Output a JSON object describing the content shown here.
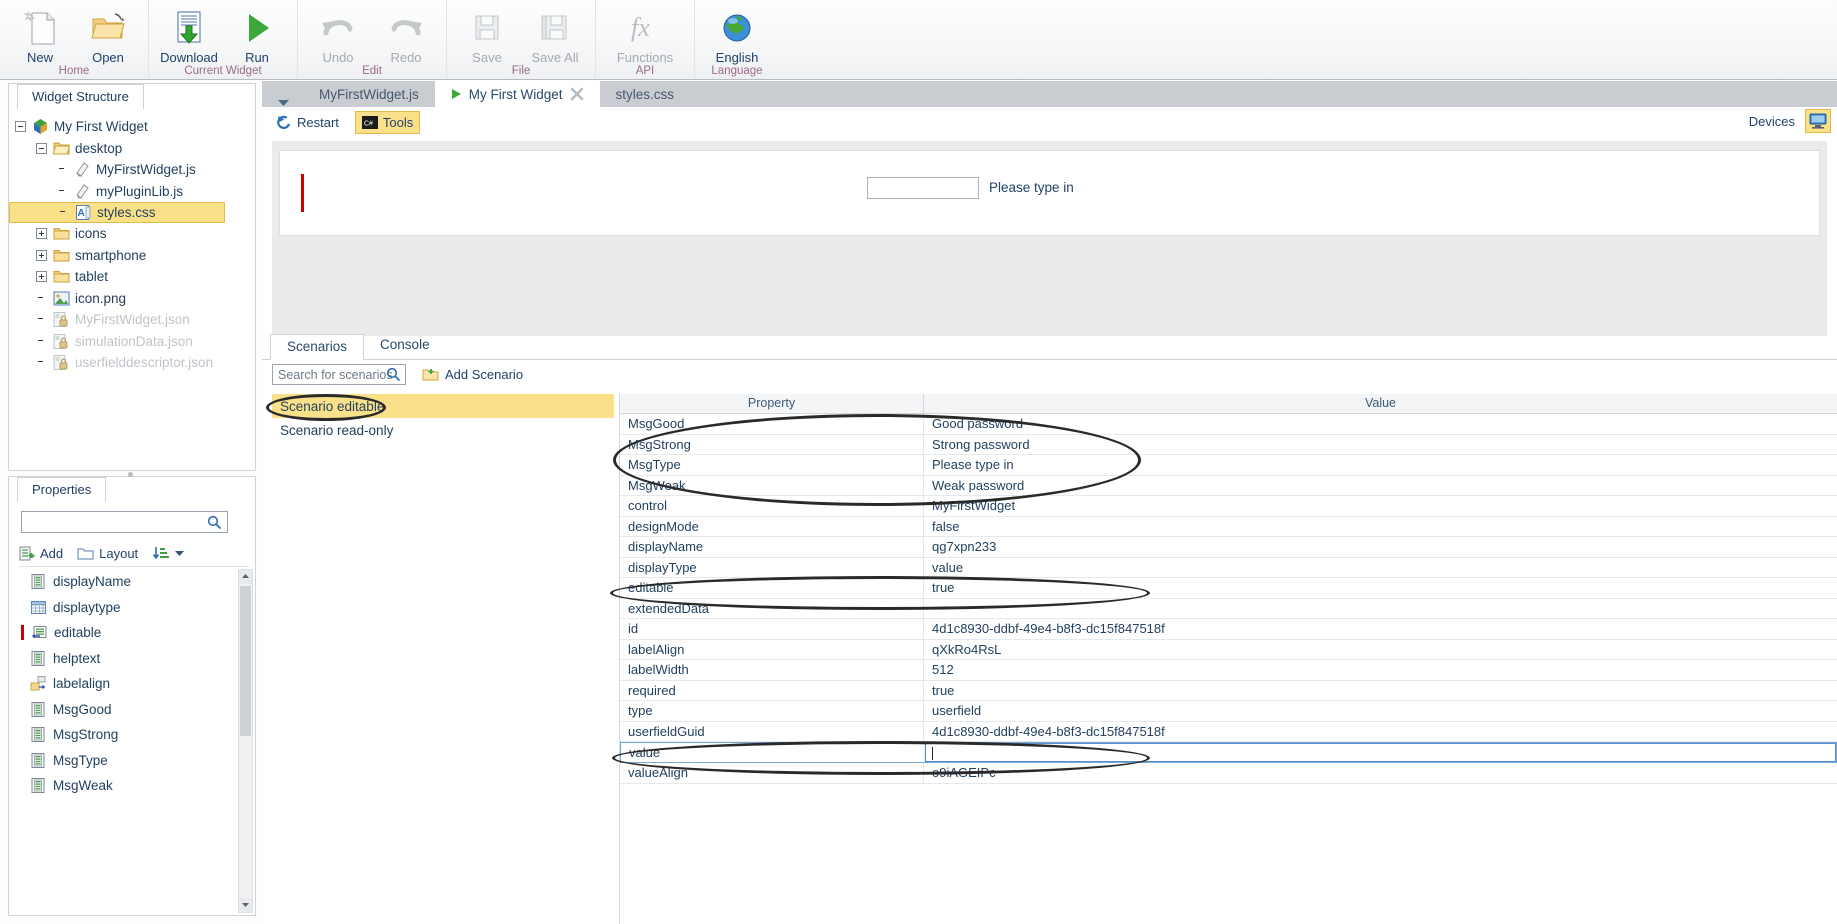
{
  "ribbon": {
    "groups": [
      {
        "label": "Home",
        "buttons": [
          {
            "name": "new",
            "label": "New",
            "icon": "new-document-icon",
            "disabled": false
          },
          {
            "name": "open",
            "label": "Open",
            "icon": "open-folder-icon",
            "disabled": false
          }
        ]
      },
      {
        "label": "Current Widget",
        "buttons": [
          {
            "name": "download",
            "label": "Download",
            "icon": "download-icon",
            "disabled": false
          },
          {
            "name": "run",
            "label": "Run",
            "icon": "run-play-icon",
            "disabled": false
          }
        ]
      },
      {
        "label": "Edit",
        "buttons": [
          {
            "name": "undo",
            "label": "Undo",
            "icon": "undo-arrow-icon",
            "disabled": true
          },
          {
            "name": "redo",
            "label": "Redo",
            "icon": "redo-arrow-icon",
            "disabled": true
          }
        ]
      },
      {
        "label": "File",
        "buttons": [
          {
            "name": "save",
            "label": "Save",
            "icon": "floppy-disk-icon",
            "disabled": true
          },
          {
            "name": "save-all",
            "label": "Save All",
            "icon": "save-all-icon",
            "disabled": true
          }
        ]
      },
      {
        "label": "API",
        "buttons": [
          {
            "name": "functions",
            "label": "Functions",
            "icon": "fx-functions-icon",
            "disabled": true
          }
        ]
      },
      {
        "label": "Language",
        "buttons": [
          {
            "name": "language",
            "label": "English",
            "icon": "globe-icon",
            "disabled": false
          }
        ]
      }
    ]
  },
  "widget_structure": {
    "tab_label": "Widget Structure",
    "nodes": [
      {
        "label": "My First Widget",
        "icon": "widget-cube-icon",
        "expander": "minus",
        "indent": 0,
        "selected": false,
        "muted": false
      },
      {
        "label": "desktop",
        "icon": "folder-open-icon",
        "expander": "minus",
        "indent": 1,
        "selected": false,
        "muted": false
      },
      {
        "label": "MyFirstWidget.js",
        "icon": "js-file-icon",
        "expander": "none",
        "indent": 2,
        "selected": false,
        "muted": false
      },
      {
        "label": "myPluginLib.js",
        "icon": "js-file-icon",
        "expander": "none",
        "indent": 2,
        "selected": false,
        "muted": false
      },
      {
        "label": "styles.css",
        "icon": "css-file-icon",
        "expander": "none",
        "indent": 2,
        "selected": true,
        "muted": false
      },
      {
        "label": "icons",
        "icon": "folder-icon",
        "expander": "plus",
        "indent": 1,
        "selected": false,
        "muted": false
      },
      {
        "label": "smartphone",
        "icon": "folder-icon",
        "expander": "plus",
        "indent": 1,
        "selected": false,
        "muted": false
      },
      {
        "label": "tablet",
        "icon": "folder-icon",
        "expander": "plus",
        "indent": 1,
        "selected": false,
        "muted": false
      },
      {
        "label": "icon.png",
        "icon": "image-file-icon",
        "expander": "none",
        "indent": 1,
        "selected": false,
        "muted": false
      },
      {
        "label": "MyFirstWidget.json",
        "icon": "locked-json-icon",
        "expander": "none",
        "indent": 1,
        "selected": false,
        "muted": true
      },
      {
        "label": "simulationData.json",
        "icon": "locked-json-icon",
        "expander": "none",
        "indent": 1,
        "selected": false,
        "muted": true
      },
      {
        "label": "userfielddescriptor.json",
        "icon": "locked-json-icon",
        "expander": "none",
        "indent": 1,
        "selected": false,
        "muted": true
      }
    ]
  },
  "properties_panel": {
    "tab_label": "Properties",
    "search_value": "",
    "search_placeholder": "",
    "toolbar": {
      "add_label": "Add",
      "layout_label": "Layout",
      "sort_label": ""
    },
    "items": [
      {
        "label": "displayName",
        "icon": "text-property-icon",
        "marked": false
      },
      {
        "label": "displaytype",
        "icon": "grid-property-icon",
        "marked": false
      },
      {
        "label": "editable",
        "icon": "boolean-property-icon",
        "marked": true
      },
      {
        "label": "helptext",
        "icon": "text-property-icon",
        "marked": false
      },
      {
        "label": "labelalign",
        "icon": "align-property-icon",
        "marked": false
      },
      {
        "label": "MsgGood",
        "icon": "text-property-icon",
        "marked": false
      },
      {
        "label": "MsgStrong",
        "icon": "text-property-icon",
        "marked": false
      },
      {
        "label": "MsgType",
        "icon": "text-property-icon",
        "marked": false
      },
      {
        "label": "MsgWeak",
        "icon": "text-property-icon",
        "marked": false
      }
    ]
  },
  "document_tabs": [
    {
      "label": "MyFirstWidget.js",
      "active": false,
      "closable": false,
      "icon": ""
    },
    {
      "label": "My First Widget",
      "active": true,
      "closable": true,
      "icon": "run-play-icon"
    },
    {
      "label": "styles.css",
      "active": false,
      "closable": false,
      "icon": ""
    }
  ],
  "run_toolbar": {
    "restart_label": "Restart",
    "tools_label": "Tools",
    "devices_label": "Devices",
    "device_icon": "desktop-monitor-icon"
  },
  "preview": {
    "input_value": "",
    "hint_text": "Please type in"
  },
  "bottom_tabs": [
    {
      "label": "Scenarios",
      "active": true
    },
    {
      "label": "Console",
      "active": false
    }
  ],
  "scenario_toolbar": {
    "search_placeholder": "Search for scenarios",
    "search_value": "",
    "add_scenario_label": "Add Scenario"
  },
  "scenarios": [
    {
      "label": "Scenario editable",
      "selected": true
    },
    {
      "label": "Scenario read-only",
      "selected": false
    }
  ],
  "property_grid": {
    "columns": [
      "Property",
      "Value"
    ],
    "rows": [
      {
        "property": "MsgGood",
        "value": "Good password",
        "editing": false
      },
      {
        "property": "MsgStrong",
        "value": "Strong password",
        "editing": false
      },
      {
        "property": "MsgType",
        "value": "Please type in",
        "editing": false
      },
      {
        "property": "MsgWeak",
        "value": "Weak password",
        "editing": false
      },
      {
        "property": "control",
        "value": "MyFirstWidget",
        "editing": false
      },
      {
        "property": "designMode",
        "value": "false",
        "editing": false
      },
      {
        "property": "displayName",
        "value": "qg7xpn233",
        "editing": false
      },
      {
        "property": "displayType",
        "value": "value",
        "editing": false
      },
      {
        "property": "editable",
        "value": "true",
        "editing": false
      },
      {
        "property": "extendedData",
        "value": "",
        "editing": false
      },
      {
        "property": "id",
        "value": "4d1c8930-ddbf-49e4-b8f3-dc15f847518f",
        "editing": false
      },
      {
        "property": "labelAlign",
        "value": "qXkRo4RsL",
        "editing": false
      },
      {
        "property": "labelWidth",
        "value": "512",
        "editing": false
      },
      {
        "property": "required",
        "value": "true",
        "editing": false
      },
      {
        "property": "type",
        "value": "userfield",
        "editing": false
      },
      {
        "property": "userfieldGuid",
        "value": "4d1c8930-ddbf-49e4-b8f3-dc15f847518f",
        "editing": false
      },
      {
        "property": "value",
        "value": "",
        "editing": true
      },
      {
        "property": "valueAlign",
        "value": "o9iAGEIPc",
        "editing": false
      }
    ]
  },
  "colors": {
    "selection": "#fbe08a",
    "selection_border": "#e3b94a",
    "annotation": "#2a2a2a",
    "accent_text": "#22426b",
    "group_label": "#9b6a8c"
  }
}
